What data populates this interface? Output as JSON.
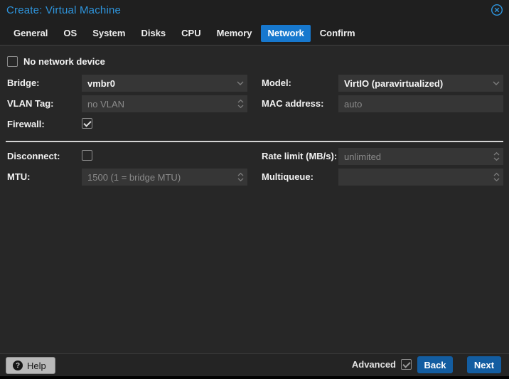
{
  "window": {
    "title": "Create: Virtual Machine"
  },
  "tabs": [
    {
      "label": "General",
      "active": false
    },
    {
      "label": "OS",
      "active": false
    },
    {
      "label": "System",
      "active": false
    },
    {
      "label": "Disks",
      "active": false
    },
    {
      "label": "CPU",
      "active": false
    },
    {
      "label": "Memory",
      "active": false
    },
    {
      "label": "Network",
      "active": true
    },
    {
      "label": "Confirm",
      "active": false
    }
  ],
  "form": {
    "no_network_device": {
      "label": "No network device",
      "checked": false
    },
    "bridge": {
      "label": "Bridge:",
      "value": "vmbr0"
    },
    "model": {
      "label": "Model:",
      "value": "VirtIO (paravirtualized)"
    },
    "vlan": {
      "label": "VLAN Tag:",
      "placeholder": "no VLAN"
    },
    "mac": {
      "label": "MAC address:",
      "placeholder": "auto"
    },
    "firewall": {
      "label": "Firewall:",
      "checked": true
    },
    "disconnect": {
      "label": "Disconnect:",
      "checked": false
    },
    "rate_limit": {
      "label": "Rate limit (MB/s):",
      "placeholder": "unlimited"
    },
    "mtu": {
      "label": "MTU:",
      "placeholder": "1500 (1 = bridge MTU)"
    },
    "multiqueue": {
      "label": "Multiqueue:",
      "placeholder": ""
    }
  },
  "footer": {
    "help_label": "Help",
    "help_icon_glyph": "?",
    "advanced_label": "Advanced",
    "advanced_checked": true,
    "back_label": "Back",
    "next_label": "Next"
  },
  "colors": {
    "accent_blue": "#2e95dd",
    "tab_active_bg": "#1778ce",
    "button_bg": "#135da1",
    "header_bg": "#1f1f1f",
    "content_bg": "#272727",
    "field_bg": "#363636",
    "placeholder_text": "#8a8a8a"
  }
}
